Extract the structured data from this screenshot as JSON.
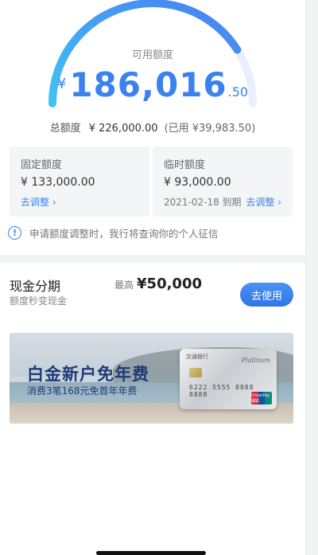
{
  "credit": {
    "available_label": "可用额度",
    "currency": "¥",
    "available_int": "186,016",
    "available_dec": ".50",
    "usage_ratio": 0.18,
    "total_label": "总额度",
    "total_value": "¥ 226,000.00",
    "used_text": "(已用 ¥39,983.50)"
  },
  "fixed": {
    "title": "固定额度",
    "value": "¥ 133,000.00",
    "link": "去调整 ›"
  },
  "temp": {
    "title": "临时额度",
    "value": "¥ 93,000.00",
    "expire": "2021-02-18 到期",
    "link": "去调整 ›"
  },
  "notice": {
    "text": "申请额度调整时，我行将查询你的个人征信"
  },
  "cash": {
    "title": "现金分期",
    "subtitle": "额度秒变现金",
    "max_label": "最高",
    "max_value": "¥50,000",
    "button": "去使用"
  },
  "banner": {
    "title": "白金新户免年费",
    "subtitle": "消费3笔168元免首年年费",
    "card_bank": "交通银行",
    "card_tier": "Platinum",
    "card_number": "6222 5555 8888 8888",
    "card_network": "UnionPay 银联"
  },
  "colors": {
    "accent": "#3b82ef",
    "gauge_start": "#3fc3f5",
    "gauge_end": "#4a7ff0",
    "gauge_track": "#e9f0fb"
  }
}
